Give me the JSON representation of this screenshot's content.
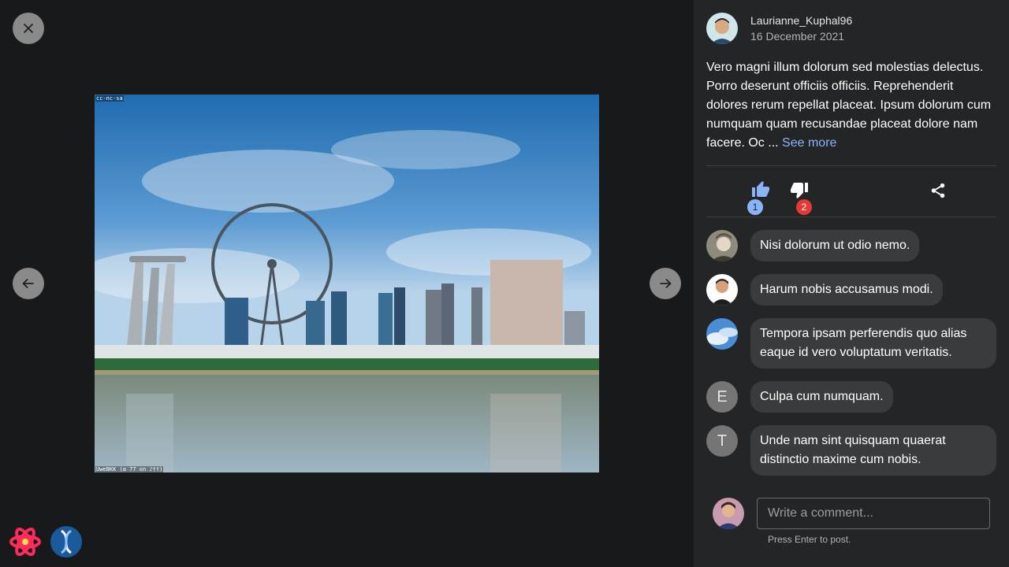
{
  "viewer": {
    "close_icon": "close-icon",
    "prev_icon": "arrow-left-icon",
    "next_icon": "arrow-right-icon",
    "photo_license": "cc-nc-sa",
    "photo_credit": "UweBKK (α 77 on ♪††)"
  },
  "app_icons": [
    "react-atom-icon",
    "dna-helix-icon"
  ],
  "post": {
    "author": "Laurianne_Kuphal96",
    "date": "16 December 2021",
    "text": "Vero magni illum dolorum sed molestias delectus. Porro deserunt officiis officiis. Reprehenderit dolores rerum repellat placeat. Ipsum dolorum cum numquam quam recusandae placeat dolore nam facere. Oc ...",
    "see_more": "See more",
    "likes": "1",
    "dislikes": "2"
  },
  "comments": [
    {
      "text": "Nisi dolorum ut odio nemo.",
      "avatar": "photo"
    },
    {
      "text": "Harum nobis accusamus modi.",
      "avatar": "photo"
    },
    {
      "text": "Tempora ipsam perferendis quo alias eaque id vero voluptatum veritatis.",
      "avatar": "photo"
    },
    {
      "text": "Culpa cum numquam.",
      "avatar": "E"
    },
    {
      "text": "Unde nam sint quisquam quaerat distinctio maxime cum nobis.",
      "avatar": "T"
    }
  ],
  "composer": {
    "placeholder": "Write a comment...",
    "hint": "Press Enter to post."
  },
  "colors": {
    "accent": "#8ab4f8",
    "dislike_badge": "#e53935",
    "panel_bg": "#242526",
    "viewer_bg": "#18191a"
  }
}
